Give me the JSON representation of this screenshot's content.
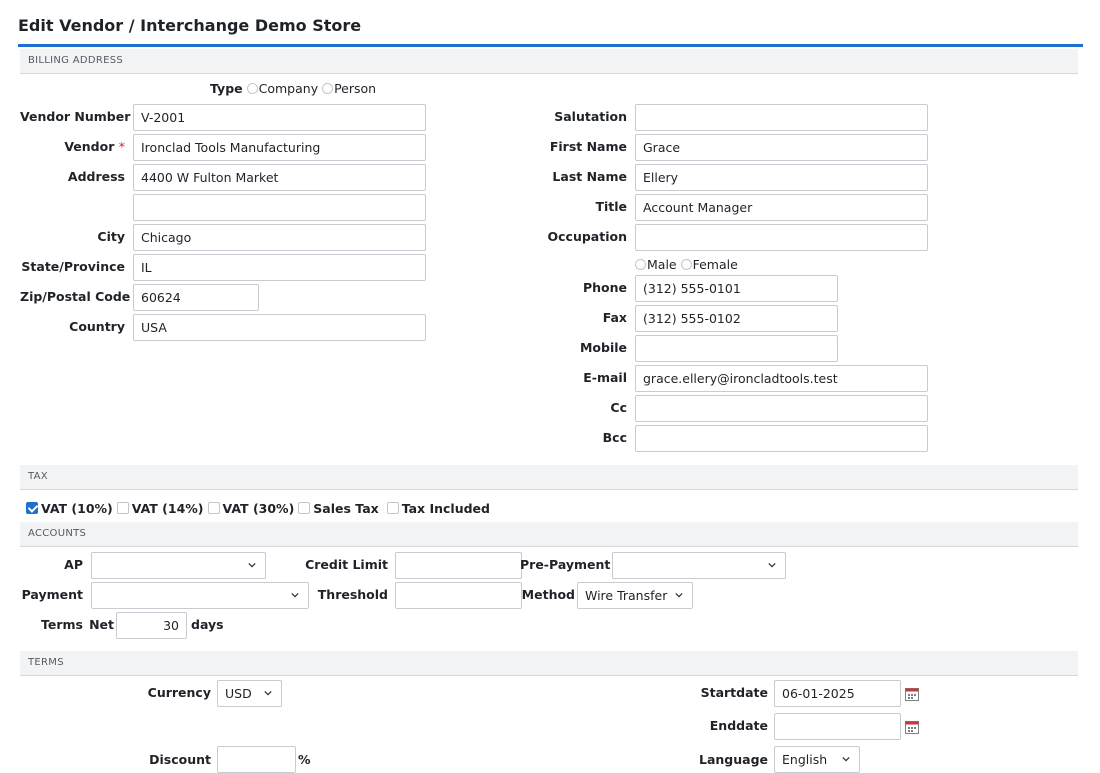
{
  "page": {
    "title": "Edit Vendor / Interchange Demo Store",
    "accent": "#1f6fd1"
  },
  "billing": {
    "header": "BILLING ADDRESS",
    "type_label": "Type",
    "type_options": [
      "Company",
      "Person"
    ],
    "vendor_number_label": "Vendor Number",
    "vendor_number": "V-2001",
    "vendor_label": "Vendor",
    "required_mark": "*",
    "vendor": "Ironclad Tools Manufacturing",
    "address_label": "Address",
    "address1": "4400 W Fulton Market",
    "address2": "",
    "city_label": "City",
    "city": "Chicago",
    "state_label": "State/Province",
    "state": "IL",
    "zip_label": "Zip/Postal Code",
    "zip": "60624",
    "country_label": "Country",
    "country": "USA",
    "salutation_label": "Salutation",
    "salutation": "",
    "first_name_label": "First Name",
    "first_name": "Grace",
    "last_name_label": "Last Name",
    "last_name": "Ellery",
    "title_label": "Title",
    "title": "Account Manager",
    "occupation_label": "Occupation",
    "occupation": "",
    "gender_options": [
      "Male",
      "Female"
    ],
    "phone_label": "Phone",
    "phone": "(312) 555-0101",
    "fax_label": "Fax",
    "fax": "(312) 555-0102",
    "mobile_label": "Mobile",
    "mobile": "",
    "email_label": "E-mail",
    "email": "grace.ellery@ironcladtools.test",
    "cc_label": "Cc",
    "cc": "",
    "bcc_label": "Bcc",
    "bcc": ""
  },
  "tax": {
    "header": "TAX",
    "items": [
      {
        "label": "VAT (10%)",
        "checked": true
      },
      {
        "label": "VAT (14%)",
        "checked": false
      },
      {
        "label": "VAT (30%)",
        "checked": false
      },
      {
        "label": "Sales Tax",
        "checked": false
      },
      {
        "label": "Tax Included",
        "checked": false
      }
    ]
  },
  "accounts": {
    "header": "ACCOUNTS",
    "ap_label": "AP",
    "ap_value": "",
    "credit_limit_label": "Credit Limit",
    "credit_limit": "",
    "prepayment_label": "Pre-Payment",
    "prepayment_value": "",
    "payment_label": "Payment",
    "payment_value": "",
    "threshold_label": "Threshold",
    "threshold": "",
    "method_label": "Method",
    "method_value": "Wire Transfer",
    "terms_label": "Terms",
    "net_label": "Net",
    "terms_days": "30",
    "days_label": "days"
  },
  "terms": {
    "header": "TERMS",
    "currency_label": "Currency",
    "currency": "USD",
    "discount_label": "Discount",
    "discount": "",
    "percent": "%",
    "startdate_label": "Startdate",
    "startdate": "06-01-2025",
    "enddate_label": "Enddate",
    "enddate": "",
    "language_label": "Language",
    "language": "English"
  }
}
